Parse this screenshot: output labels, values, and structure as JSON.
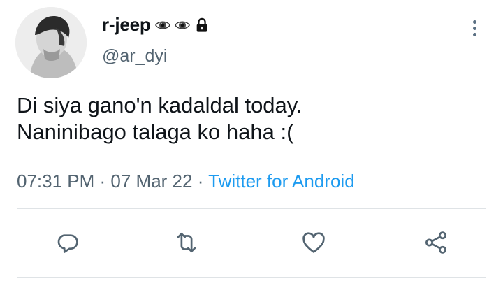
{
  "user": {
    "display_name": "r-jeep",
    "handle": "@ar_dyi",
    "name_emojis": [
      "eye-emoji",
      "eye-emoji",
      "locked-icon"
    ]
  },
  "tweet": {
    "lines": [
      "Di siya gano'n kadaldal today.",
      "Naninibago talaga ko haha :("
    ]
  },
  "meta": {
    "time": "07:31 PM",
    "sep1": " · ",
    "date": "07 Mar 22",
    "sep2": " · ",
    "source": "Twitter for Android"
  },
  "actions": [
    "reply-icon",
    "retweet-icon",
    "like-icon",
    "share-icon"
  ],
  "colors": {
    "text": "#0f1419",
    "secondary": "#536471",
    "accent": "#1d9bf0",
    "divider": "#dfe3e6"
  }
}
